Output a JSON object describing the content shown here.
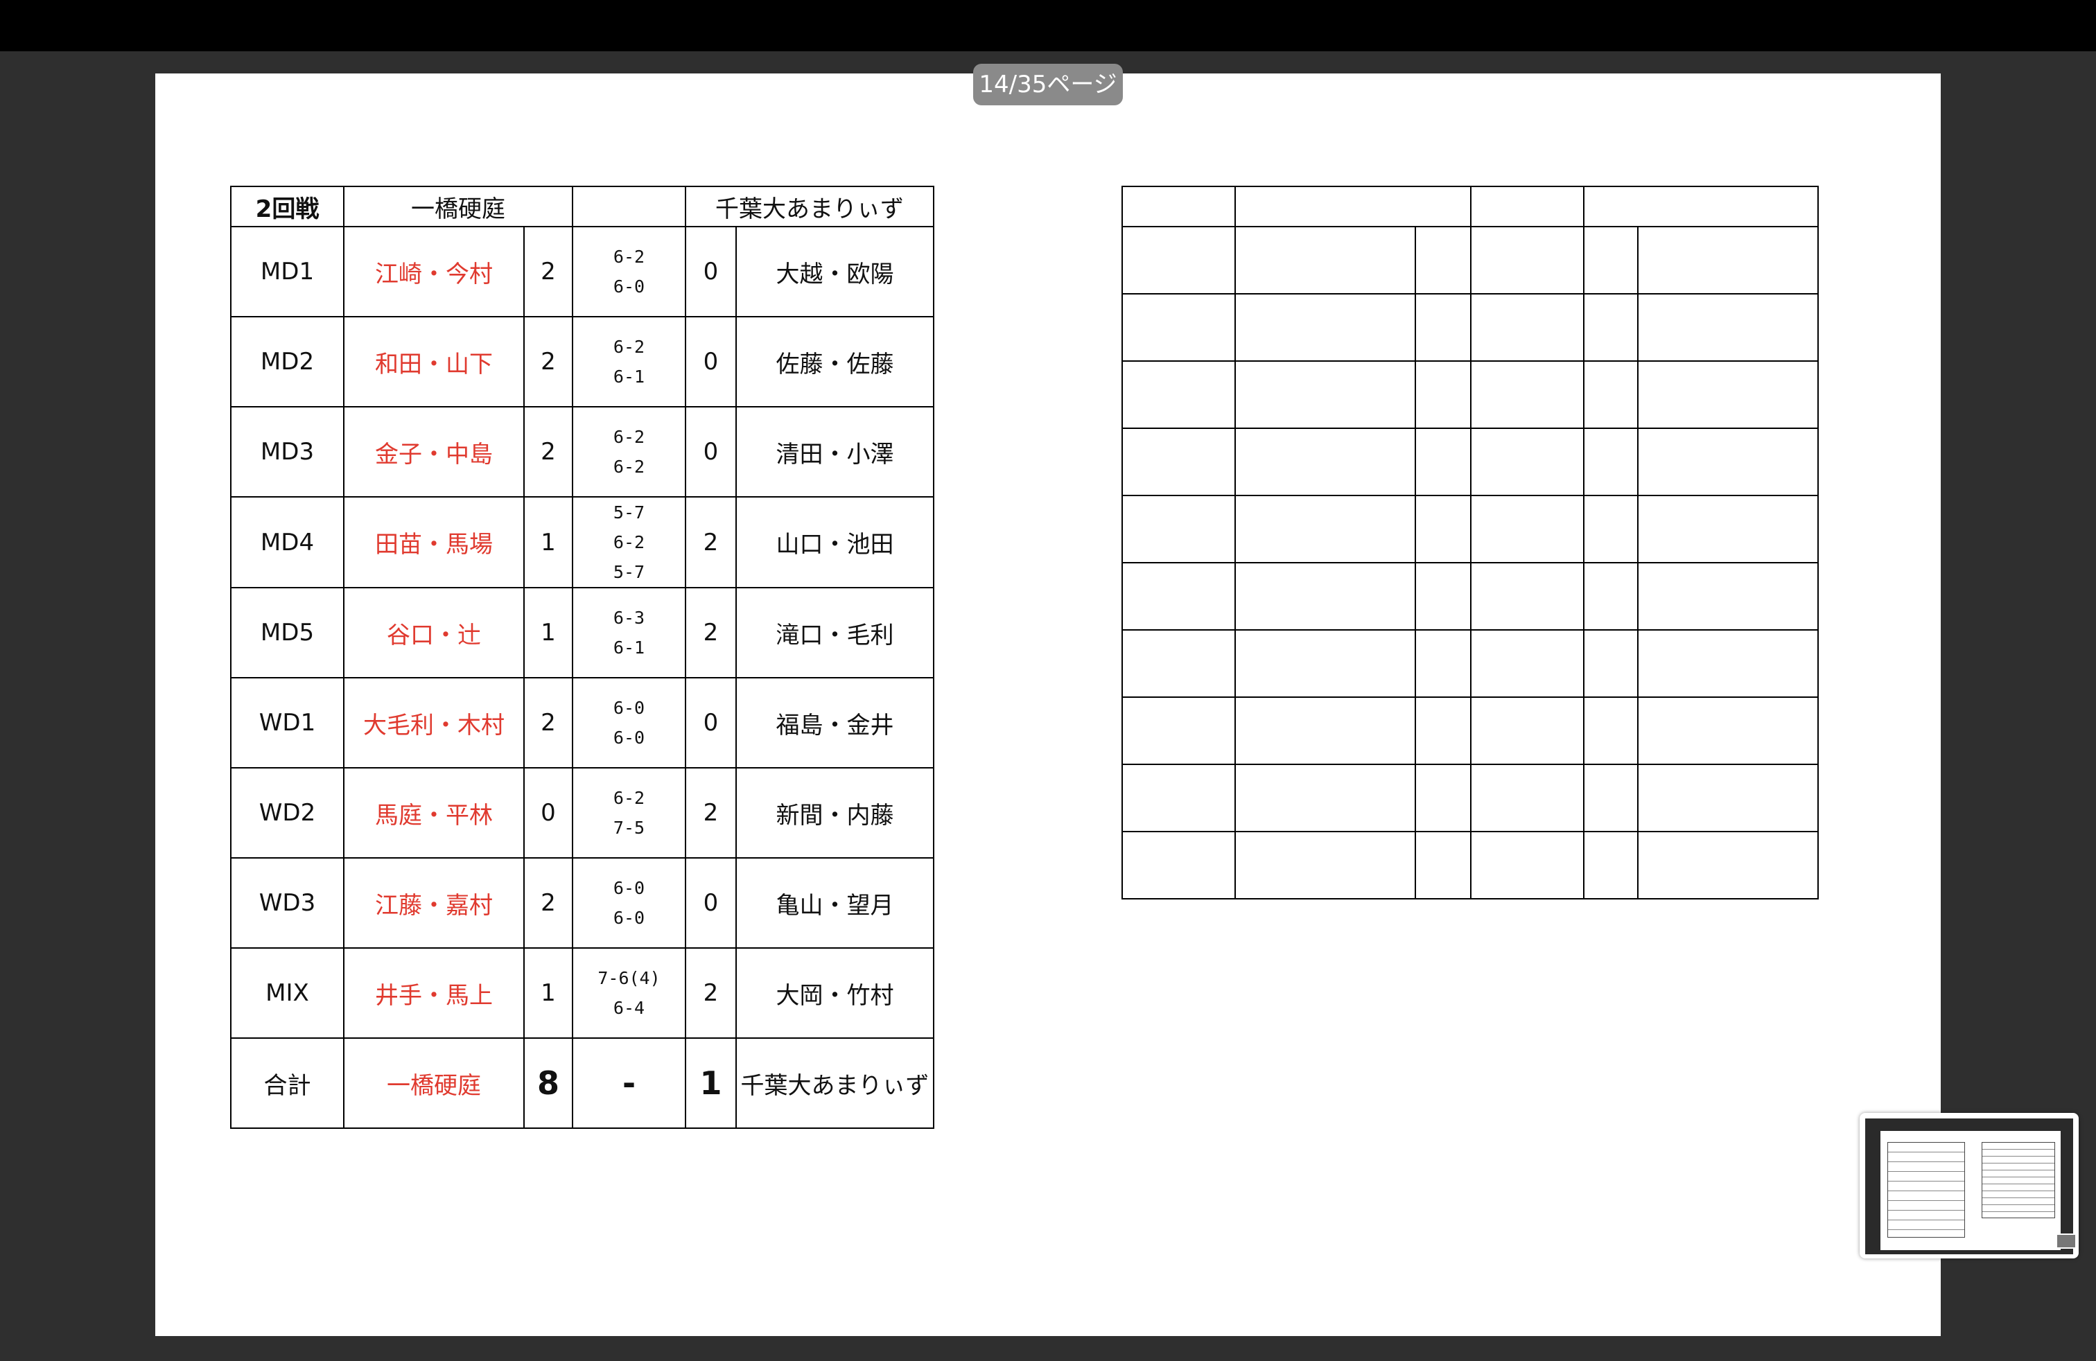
{
  "viewer": {
    "page_indicator": "14/35ページ"
  },
  "results": {
    "header": {
      "round": "2回戦",
      "home_team": "一橋硬庭",
      "away_team": "千葉大あまりぃず"
    },
    "matches": [
      {
        "event": "MD1",
        "home_pair": "江崎・今村",
        "home_sets": "2",
        "scores": [
          "6-2",
          "6-0"
        ],
        "away_sets": "0",
        "away_pair": "大越・欧陽"
      },
      {
        "event": "MD2",
        "home_pair": "和田・山下",
        "home_sets": "2",
        "scores": [
          "6-2",
          "6-1"
        ],
        "away_sets": "0",
        "away_pair": "佐藤・佐藤"
      },
      {
        "event": "MD3",
        "home_pair": "金子・中島",
        "home_sets": "2",
        "scores": [
          "6-2",
          "6-2"
        ],
        "away_sets": "0",
        "away_pair": "清田・小澤"
      },
      {
        "event": "MD4",
        "home_pair": "田苗・馬場",
        "home_sets": "1",
        "scores": [
          "5-7",
          "6-2",
          "5-7"
        ],
        "away_sets": "2",
        "away_pair": "山口・池田"
      },
      {
        "event": "MD5",
        "home_pair": "谷口・辻",
        "home_sets": "1",
        "scores": [
          "6-3",
          "6-1"
        ],
        "away_sets": "2",
        "away_pair": "滝口・毛利"
      },
      {
        "event": "WD1",
        "home_pair": "大毛利・木村",
        "home_sets": "2",
        "scores": [
          "6-0",
          "6-0"
        ],
        "away_sets": "0",
        "away_pair": "福島・金井"
      },
      {
        "event": "WD2",
        "home_pair": "馬庭・平林",
        "home_sets": "0",
        "scores": [
          "6-2",
          "7-5"
        ],
        "away_sets": "2",
        "away_pair": "新間・内藤"
      },
      {
        "event": "WD3",
        "home_pair": "江藤・嘉村",
        "home_sets": "2",
        "scores": [
          "6-0",
          "6-0"
        ],
        "away_sets": "0",
        "away_pair": "亀山・望月"
      },
      {
        "event": "MIX",
        "home_pair": "井手・馬上",
        "home_sets": "1",
        "scores": [
          "7-6(4)",
          "6-4"
        ],
        "away_sets": "2",
        "away_pair": "大岡・竹村"
      }
    ],
    "total": {
      "label": "合計",
      "home_team": "一橋硬庭",
      "home_wins": "8",
      "separator": "-",
      "away_wins": "1",
      "away_team": "千葉大あまりぃず"
    }
  },
  "colors": {
    "home_pair_text": "#e03a2f",
    "page_bg": "#ffffff",
    "viewer_bg": "#2f2f2f"
  }
}
